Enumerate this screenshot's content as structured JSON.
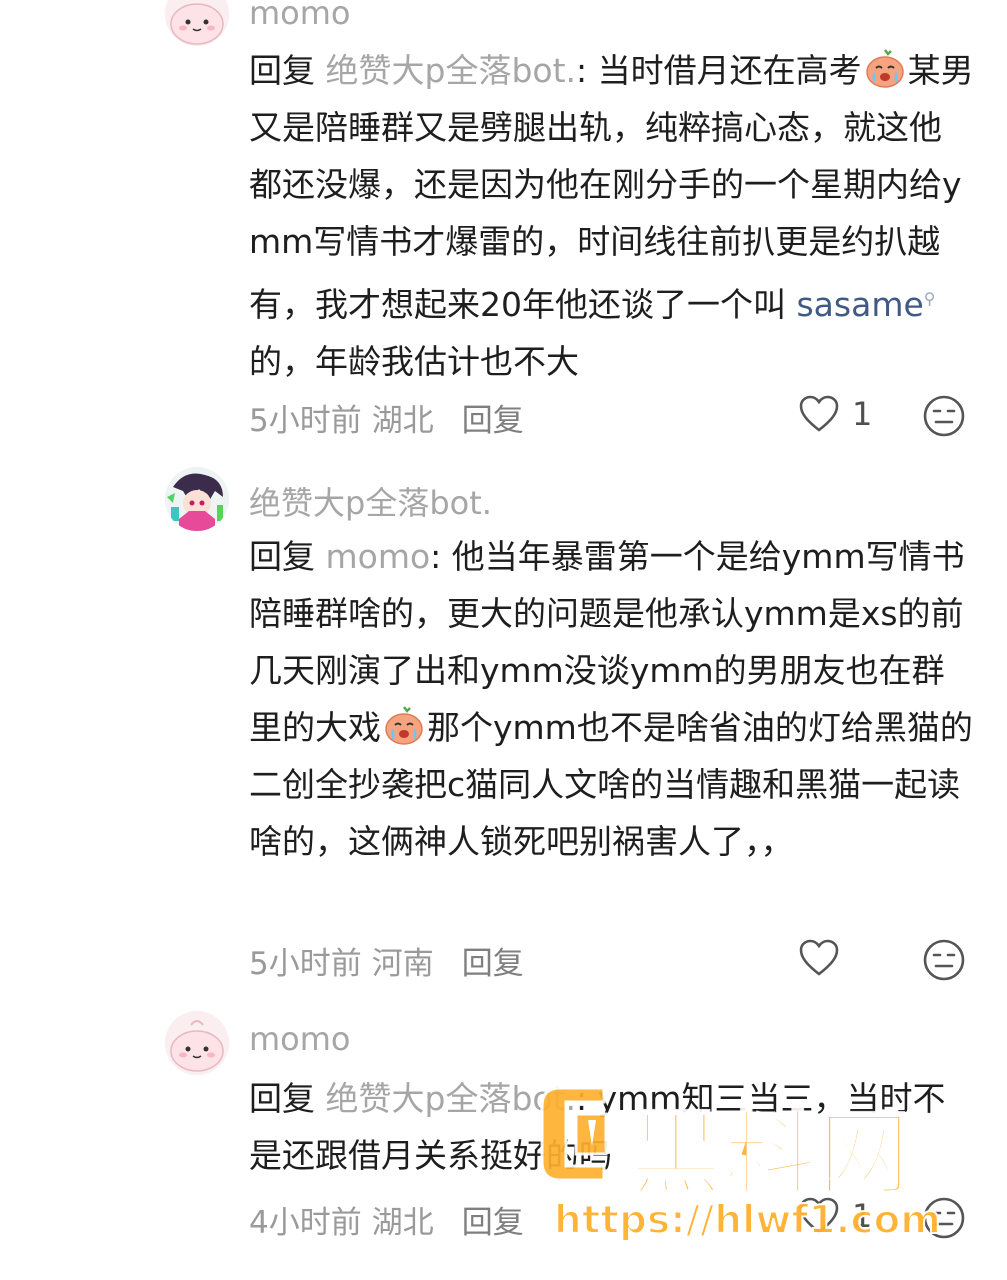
{
  "comments": [
    {
      "username": "momo",
      "reply_prefix": "回复",
      "reply_target": "绝赞大p全落bot.",
      "text_1": ": 当时借月还在高考",
      "text_2": "某男又是陪睡群又是劈腿出轨，纯粹搞心态，就这他都还没爆，还是因为他在刚分手的一个星期内给ymm写情书才爆雷的，时间线往前扒更是约扒越有，我才想起来20年他还谈了一个叫 ",
      "link_text": "sasame",
      "text_3": " 的，年龄我估计也不大",
      "emoji": "crying-face-emoji",
      "time": "5小时前",
      "location": "湖北",
      "reply_label": "回复",
      "like_count": "1"
    },
    {
      "username": "绝赞大p全落bot.",
      "reply_prefix": "回复",
      "reply_target": "momo",
      "text_1": ": 他当年暴雷第一个是给ymm写情书陪睡群啥的，更大的问题是他承认ymm是xs的前几天刚演了出和ymm没谈ymm的男朋友也在群里的大戏",
      "text_2": "那个ymm也不是啥省油的灯给黑猫的二创全抄袭把c猫同人文啥的当情趣和黑猫一起读啥的，这俩神人锁死吧别祸害人了，，",
      "emoji": "crying-face-emoji",
      "time": "5小时前",
      "location": "河南",
      "reply_label": "回复",
      "like_count": ""
    },
    {
      "username": "momo",
      "reply_prefix": "回复",
      "reply_target": "绝赞大p全落bot.",
      "text_1": ": ymm知三当三，当时不是还跟借月关系挺好的吗",
      "time": "4小时前",
      "location": "湖北",
      "reply_label": "回复",
      "like_count": "1"
    }
  ],
  "watermark": {
    "logo_text": "黑料网",
    "url": "https://hlwf1.com"
  },
  "colors": {
    "text": "#1e1e1e",
    "muted": "#a6a6a6",
    "link": "#3f5b85",
    "watermark": "#ffb02e"
  }
}
